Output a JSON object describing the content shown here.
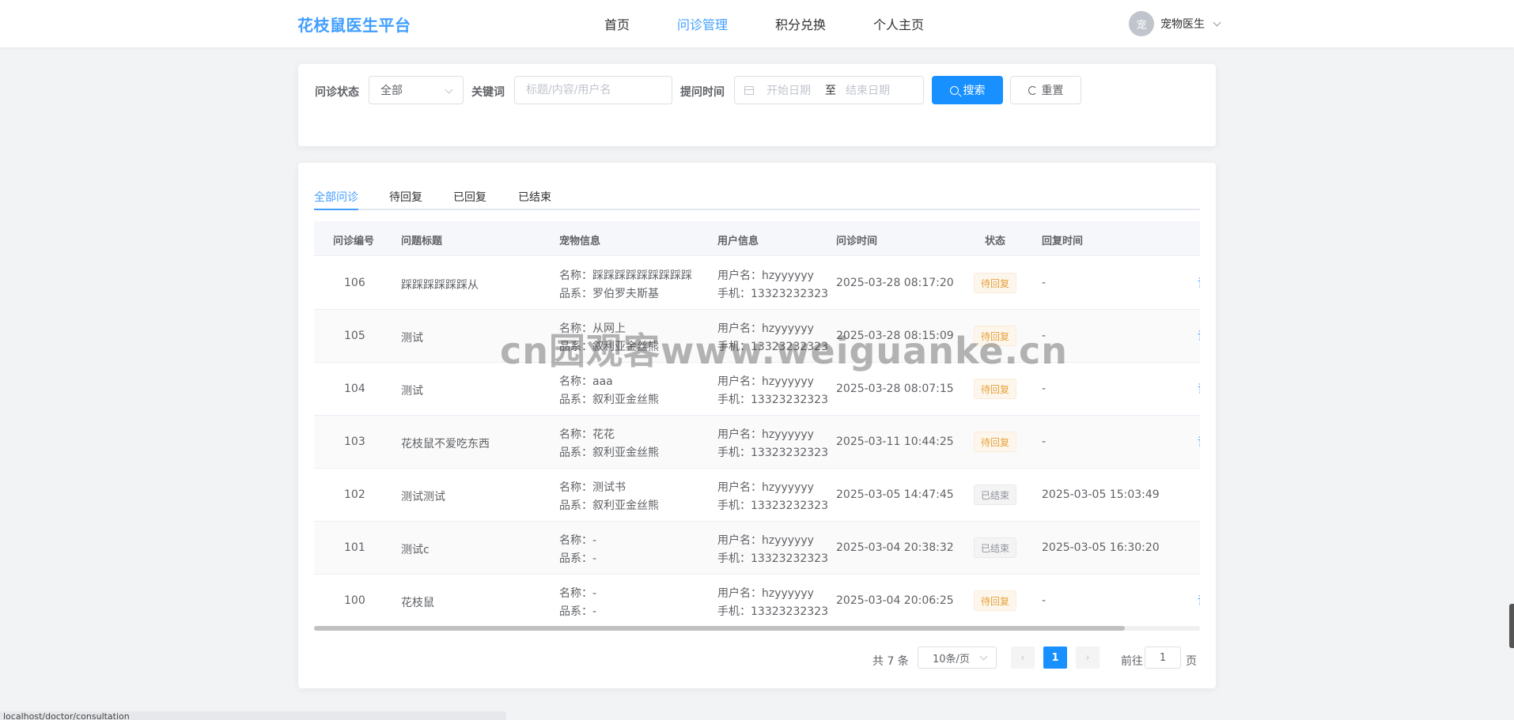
{
  "header": {
    "brand": "花枝鼠医生平台",
    "nav": [
      "首页",
      "问诊管理",
      "积分兑换",
      "个人主页"
    ],
    "nav_active": "问诊管理",
    "avatar_text": "宠",
    "user_name": "宠物医生"
  },
  "filter": {
    "status_label": "问诊状态",
    "status_value": "全部",
    "keyword_label": "关键词",
    "keyword_placeholder": "标题/内容/用户名",
    "time_label": "提问时间",
    "start_placeholder": "开始日期",
    "range_sep": "至",
    "end_placeholder": "结束日期",
    "search_button": "搜索",
    "reset_button": "重置"
  },
  "tabs": [
    "全部问诊",
    "待回复",
    "已回复",
    "已结束"
  ],
  "table": {
    "columns": [
      "问诊编号",
      "问题标题",
      "宠物信息",
      "用户信息",
      "问诊时间",
      "状态",
      "回复时间"
    ],
    "rows": [
      {
        "id": "106",
        "title": "踩踩踩踩踩踩从",
        "pet_name": "名称：踩踩踩踩踩踩踩踩踩",
        "pet_breed": "品系：罗伯罗夫斯基",
        "user": "用户名：hzyyyyyy",
        "phone": "手机：13323232323",
        "time": "2025-03-28 08:17:20",
        "status": "待回复",
        "reply_time": "-"
      },
      {
        "id": "105",
        "title": "测试",
        "pet_name": "名称：从网上",
        "pet_breed": "品系：叙利亚金丝熊",
        "user": "用户名：hzyyyyyy",
        "phone": "手机：13323232323",
        "time": "2025-03-28 08:15:09",
        "status": "待回复",
        "reply_time": "-"
      },
      {
        "id": "104",
        "title": "测试",
        "pet_name": "名称：aaa",
        "pet_breed": "品系：叙利亚金丝熊",
        "user": "用户名：hzyyyyyy",
        "phone": "手机：13323232323",
        "time": "2025-03-28 08:07:15",
        "status": "待回复",
        "reply_time": "-"
      },
      {
        "id": "103",
        "title": "花枝鼠不爱吃东西",
        "pet_name": "名称：花花",
        "pet_breed": "品系：叙利亚金丝熊",
        "user": "用户名：hzyyyyyy",
        "phone": "手机：13323232323",
        "time": "2025-03-11 10:44:25",
        "status": "待回复",
        "reply_time": "-"
      },
      {
        "id": "102",
        "title": "测试测试",
        "pet_name": "名称：测试书",
        "pet_breed": "品系：叙利亚金丝熊",
        "user": "用户名：hzyyyyyy",
        "phone": "手机：13323232323",
        "time": "2025-03-05 14:47:45",
        "status": "已结束",
        "reply_time": "2025-03-05 15:03:49"
      },
      {
        "id": "101",
        "title": "测试c",
        "pet_name": "名称：-",
        "pet_breed": "品系：-",
        "user": "用户名：hzyyyyyy",
        "phone": "手机：13323232323",
        "time": "2025-03-04 20:38:32",
        "status": "已结束",
        "reply_time": "2025-03-05 16:30:20"
      },
      {
        "id": "100",
        "title": "花枝鼠",
        "pet_name": "名称：-",
        "pet_breed": "品系：-",
        "user": "用户名：hzyyyyyy",
        "phone": "手机：13323232323",
        "time": "2025-03-04 20:06:25",
        "status": "待回复",
        "reply_time": "-"
      }
    ]
  },
  "pagination": {
    "total": "共 7 条",
    "page_size": "10条/页",
    "current": "1",
    "goto_prefix": "前往",
    "goto_value": "1",
    "goto_suffix": "页"
  },
  "watermark": "cn园观客www.weiguanke.cn",
  "statusbar": "localhost/doctor/consultation",
  "colors": {
    "primary": "#1890ff",
    "warning": "#e6a23c",
    "info": "#909399"
  }
}
